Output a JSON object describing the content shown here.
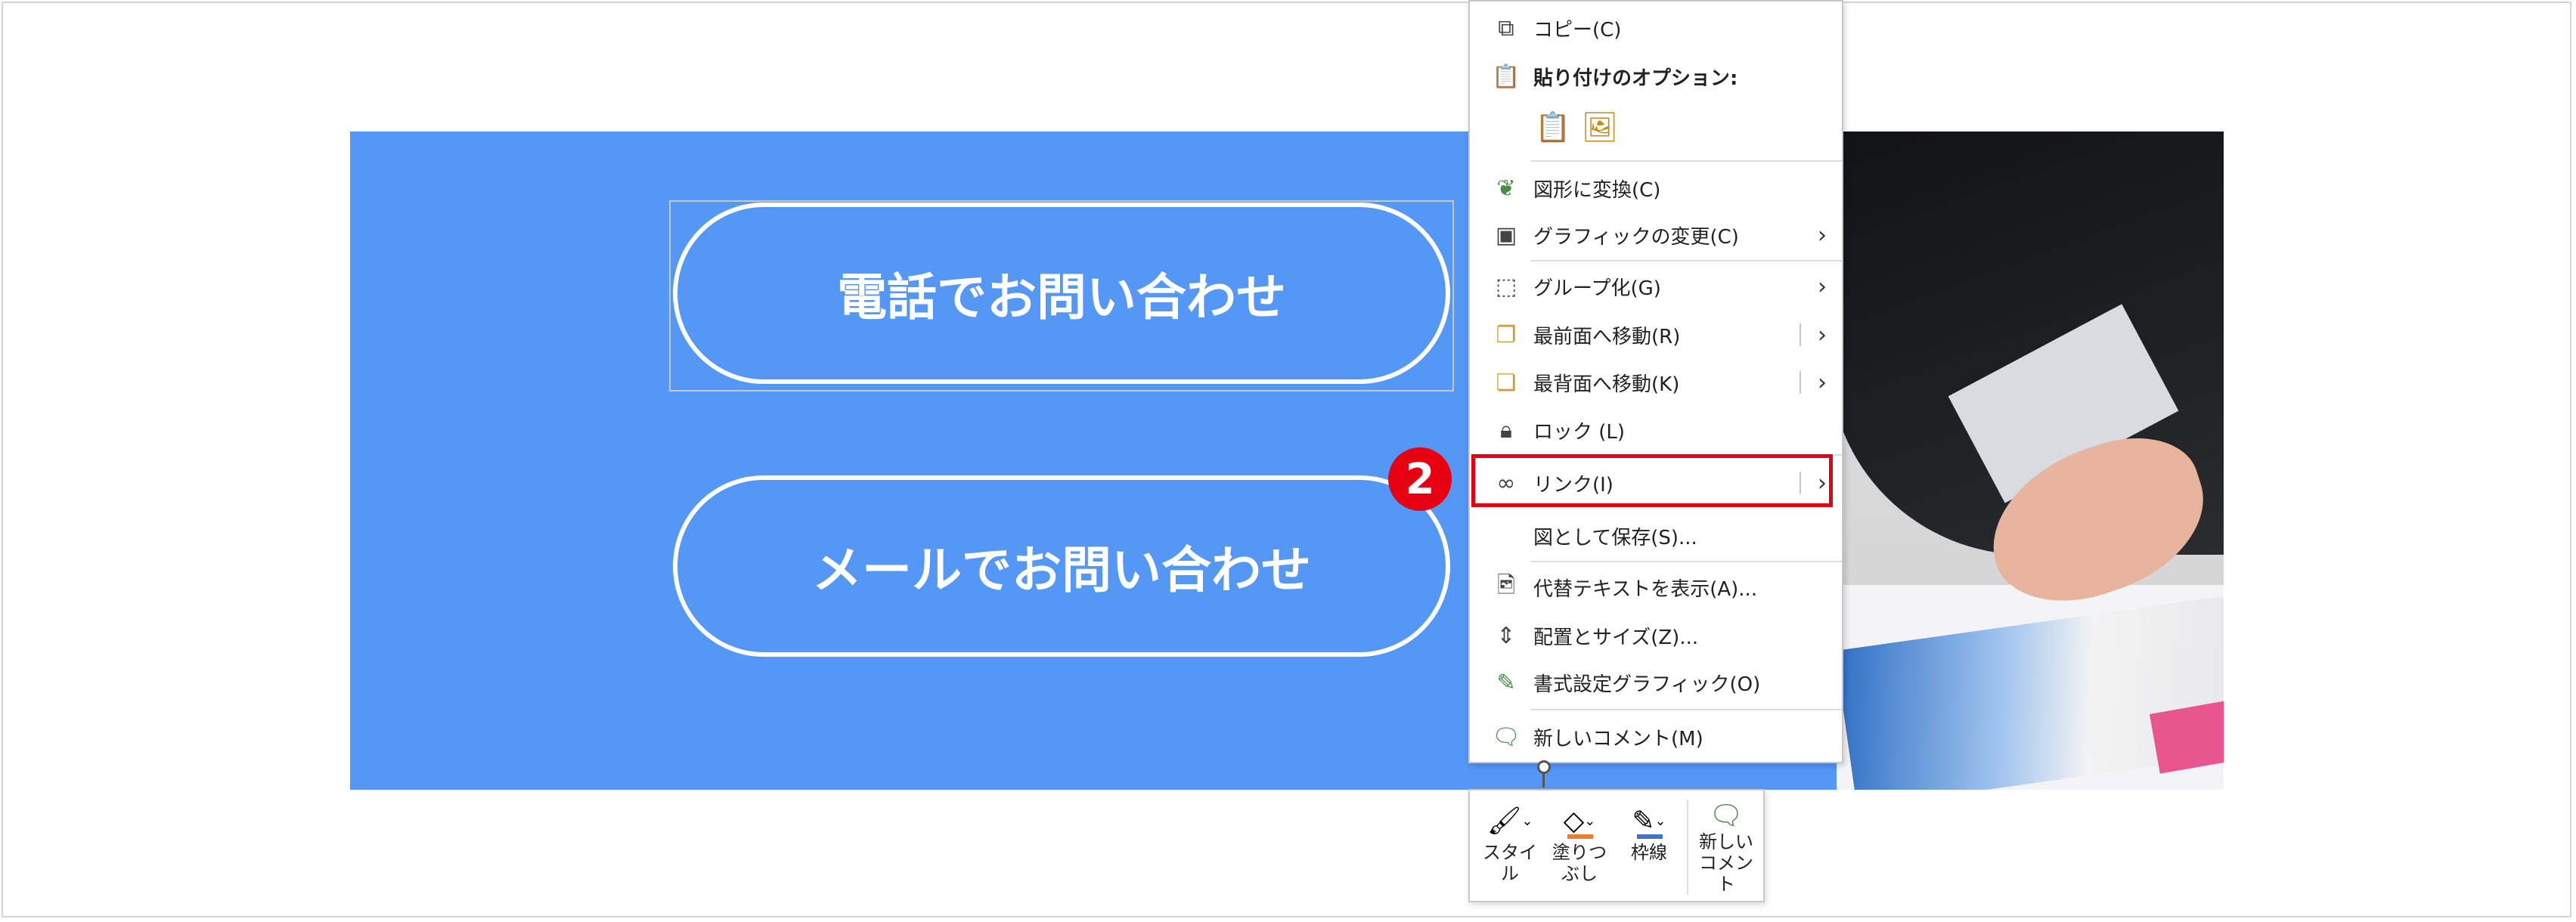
{
  "slide": {
    "phone_button": "電話でお問い合わせ",
    "mail_button": "メールでお問い合わせ"
  },
  "context_menu": {
    "copy": "コピー(C)",
    "paste_options": "貼り付けのオプション:",
    "convert_to_shape": "図形に変換(C)",
    "change_graphic": "グラフィックの変更(C)",
    "group": "グループ化(G)",
    "bring_to_front": "最前面へ移動(R)",
    "send_to_back": "最背面へ移動(K)",
    "lock": "ロック (L)",
    "link": "リンク(I)",
    "save_as_picture": "図として保存(S)...",
    "alt_text": "代替テキストを表示(A)...",
    "size_position": "配置とサイズ(Z)...",
    "format_graphic": "書式設定グラフィック(O)",
    "new_comment": "新しいコメント(M)"
  },
  "step_badge": "2",
  "mini_toolbar": {
    "style": "スタイル",
    "fill": "塗りつ\nぶし",
    "outline": "枠線",
    "comment": "新しい\nコメント"
  },
  "colors": {
    "slide_blue": "#5497f5",
    "highlight_red": "#e60012",
    "fill_orange": "#ed7d31",
    "outline_blue": "#4472c4"
  }
}
